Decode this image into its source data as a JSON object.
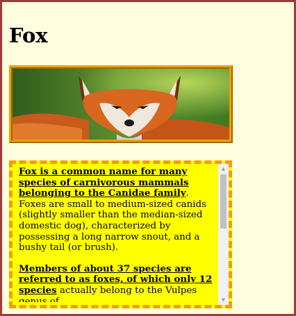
{
  "page": {
    "title": "Fox",
    "frame_color": "#a33a3a",
    "background_color": "#ffffe0"
  },
  "image": {
    "subject": "red fox photo",
    "border_color": "#f0a000"
  },
  "article": {
    "panel_color": "#ffff00",
    "border_color": "#f0a000",
    "p1_bold": "Fox is a common name for many species of carnivorous mammals belonging to the Canidae family",
    "p1_rest": ". Foxes are small to medium-sized canids (slightly smaller than the median-sized domestic dog), characterized by possessing a long narrow snout, and a bushy tail (or brush).",
    "p2_bold": "Members of about 37 species are referred to as foxes, of which only 12 species",
    "p2_rest": " actually belong to the Vulpes genus of"
  },
  "scrollbar": {
    "up_arrow_icon": "triangle-up",
    "down_arrow_icon": "triangle-down",
    "position": 0
  }
}
